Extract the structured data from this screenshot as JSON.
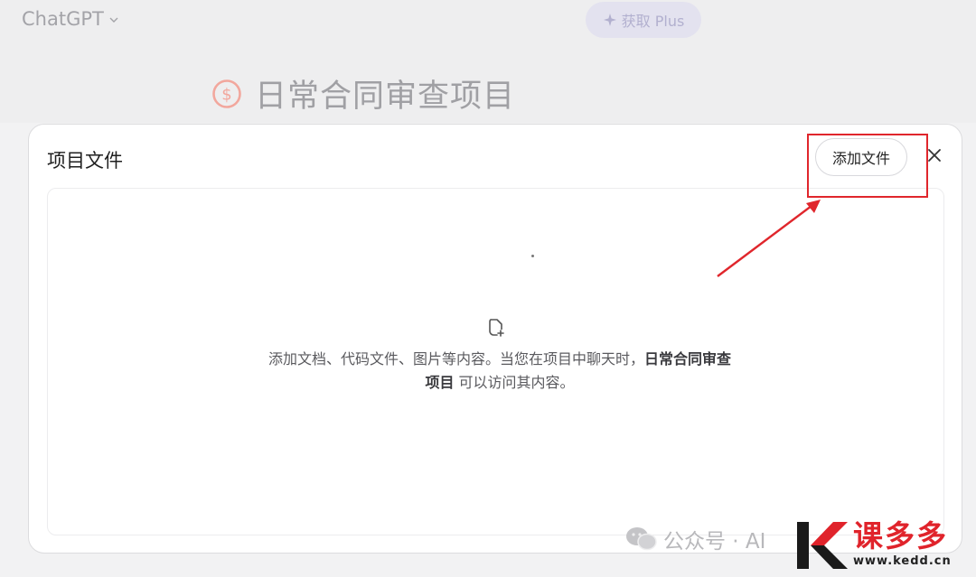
{
  "topbar": {
    "brand": "ChatGPT",
    "upgrade_label": "获取 Plus"
  },
  "project": {
    "title": "日常合同审查项目"
  },
  "modal": {
    "title": "项目文件",
    "add_file_label": "添加文件",
    "empty_text_before": "添加文档、代码文件、图片等内容。当您在项目中聊天时，",
    "empty_text_project": "日常合同审查项目",
    "empty_text_after": " 可以访问其内容。"
  },
  "watermark": {
    "text": "公众号 · AI"
  },
  "logo": {
    "name": "课多多",
    "url": "www.kedd.cn"
  },
  "colors": {
    "annotation_red": "#e0262c",
    "logo_red": "#e0232b"
  },
  "icons": [
    "chevron-down-icon",
    "sparkle-icon",
    "dollar-coin-icon",
    "close-icon",
    "file-plus-icon",
    "wechat-icon"
  ]
}
